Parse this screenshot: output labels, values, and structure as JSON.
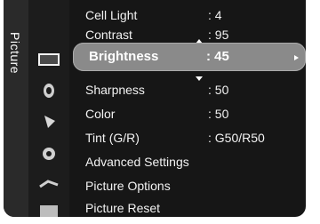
{
  "sidebar": {
    "title": "Picture"
  },
  "menu": {
    "items": [
      {
        "label": "Cell Light",
        "value": ": 4"
      },
      {
        "label": "Contrast",
        "value": ": 95"
      },
      {
        "label": "Brightness",
        "value": ": 45"
      },
      {
        "label": "Sharpness",
        "value": ": 50"
      },
      {
        "label": "Color",
        "value": ": 50"
      },
      {
        "label": "Tint (G/R)",
        "value": ": G50/R50"
      },
      {
        "label": "Advanced Settings",
        "value": ""
      },
      {
        "label": "Picture Options",
        "value": ""
      },
      {
        "label": "Picture Reset",
        "value": ""
      }
    ]
  },
  "icons": [
    "picture-icon",
    "sound-icon",
    "channel-icon",
    "setup-icon",
    "input-icon",
    "support-icon"
  ]
}
